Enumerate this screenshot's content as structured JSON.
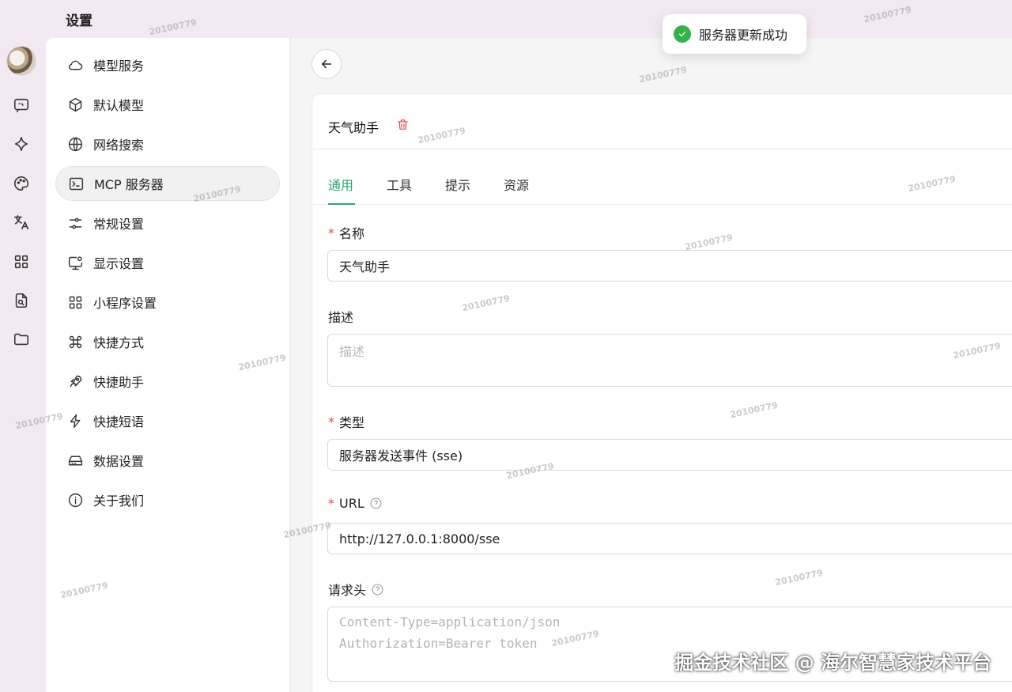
{
  "window": {
    "title": "设置"
  },
  "rail": {
    "items": [
      {
        "icon": "chat-icon"
      },
      {
        "icon": "sparkle-icon"
      },
      {
        "icon": "palette-icon"
      },
      {
        "icon": "translate-icon"
      },
      {
        "icon": "apps-grid-icon"
      },
      {
        "icon": "file-search-icon"
      },
      {
        "icon": "folder-icon"
      }
    ]
  },
  "menu": {
    "items": [
      {
        "label": "模型服务",
        "icon": "cloud-icon"
      },
      {
        "label": "默认模型",
        "icon": "cube-icon"
      },
      {
        "label": "网络搜索",
        "icon": "globe-icon"
      },
      {
        "label": "MCP 服务器",
        "icon": "terminal-icon",
        "active": true
      },
      {
        "label": "常规设置",
        "icon": "sliders-icon"
      },
      {
        "label": "显示设置",
        "icon": "monitor-settings-icon"
      },
      {
        "label": "小程序设置",
        "icon": "grid-icon"
      },
      {
        "label": "快捷方式",
        "icon": "command-icon"
      },
      {
        "label": "快捷助手",
        "icon": "rocket-icon"
      },
      {
        "label": "快捷短语",
        "icon": "lightning-icon"
      },
      {
        "label": "数据设置",
        "icon": "hard-drive-icon"
      },
      {
        "label": "关于我们",
        "icon": "info-icon"
      }
    ]
  },
  "server": {
    "name": "天气助手",
    "tabs": [
      "通用",
      "工具",
      "提示",
      "资源"
    ],
    "active_tab": "通用",
    "fields": {
      "name_label": "名称",
      "name_value": "天气助手",
      "desc_label": "描述",
      "desc_placeholder": "描述",
      "type_label": "类型",
      "type_value": "服务器发送事件 (sse)",
      "url_label": "URL",
      "url_value": "http://127.0.0.1:8000/sse",
      "headers_label": "请求头",
      "headers_placeholder_line1": "Content-Type=application/json",
      "headers_placeholder_line2": "Authorization=Bearer token"
    }
  },
  "toast": {
    "text": "服务器更新成功",
    "color": "#34b24a"
  },
  "brand_watermark": "掘金技术社区 @ 海尔智慧家技术平台",
  "watermark_text": "20100779",
  "colors": {
    "accent": "#2aa56f",
    "danger": "#e04848",
    "background": "#f3e9f3"
  }
}
